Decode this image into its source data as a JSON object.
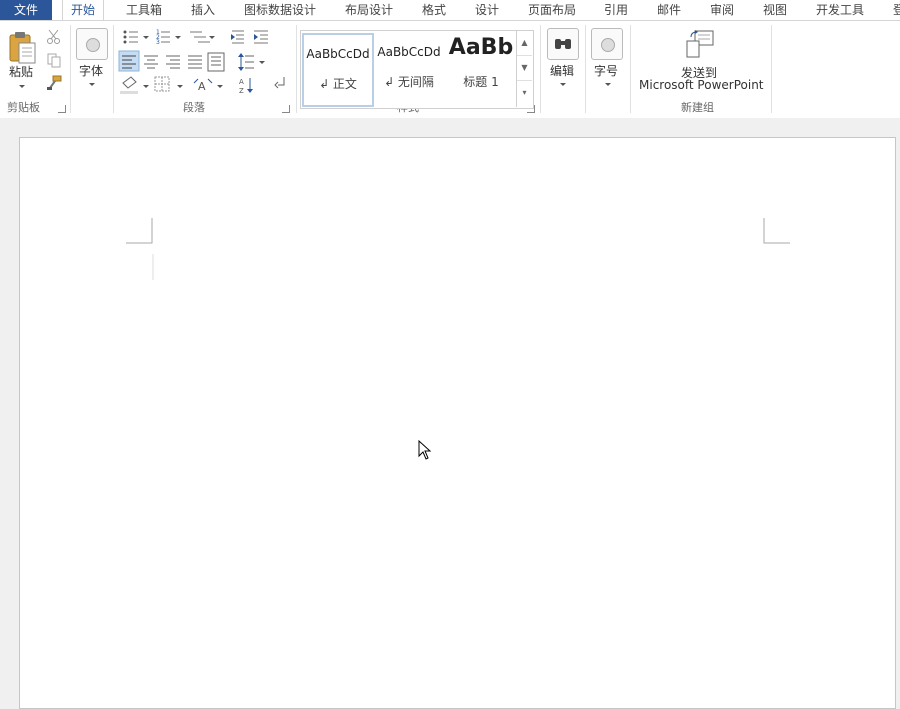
{
  "tabs": {
    "file": "文件",
    "items": [
      "开始",
      "工具箱",
      "插入",
      "图标数据设计",
      "布局设计",
      "格式",
      "设计",
      "页面布局",
      "引用",
      "邮件",
      "审阅",
      "视图",
      "开发工具",
      "登"
    ]
  },
  "ribbon": {
    "clipboard": {
      "paste_label": "粘贴",
      "group_label": "剪贴板"
    },
    "font": {
      "button_label": "字体"
    },
    "paragraph": {
      "group_label": "段落"
    },
    "styles": {
      "group_label": "样式",
      "items": [
        {
          "sample": "AaBbCcDd",
          "name": "↲ 正文"
        },
        {
          "sample": "AaBbCcDd",
          "name": "↲ 无间隔"
        },
        {
          "sample": "AaBb",
          "name": "标题 1"
        }
      ]
    },
    "editing": {
      "button_label": "编辑"
    },
    "font_size": {
      "button_label": "字号"
    },
    "new_group": {
      "button_line1": "发送到",
      "button_line2": "Microsoft PowerPoint",
      "group_label": "新建组"
    }
  },
  "colors": {
    "accent": "#2b579a",
    "ribbon_bg": "#ffffff",
    "workspace_bg": "#f0f0f0"
  }
}
